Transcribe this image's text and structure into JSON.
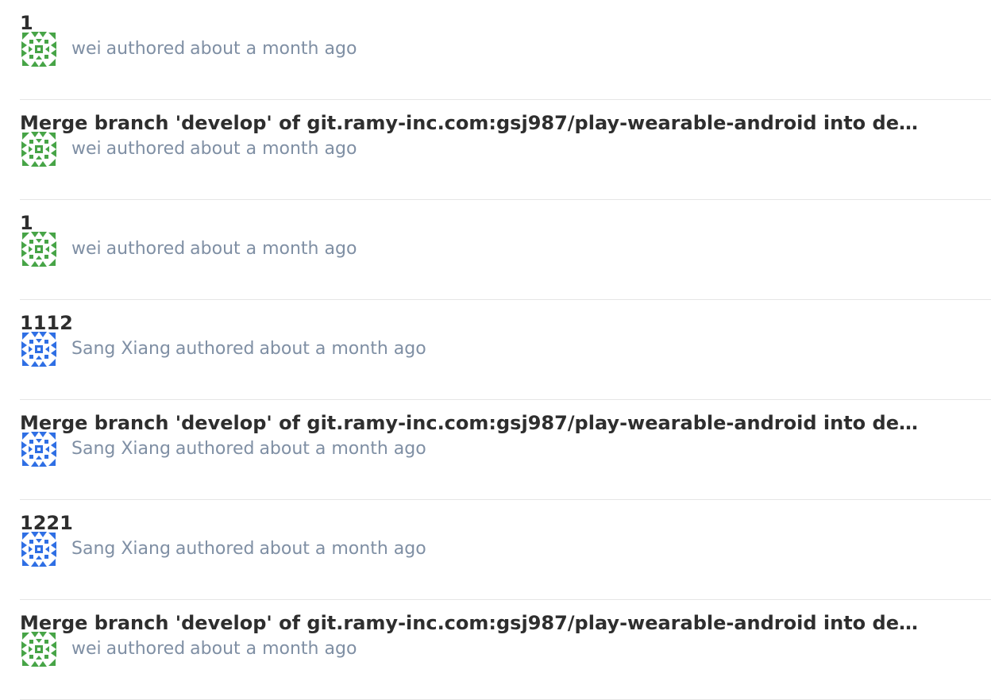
{
  "identicons": {
    "green": "#47a447",
    "blue": "#2f6fe4"
  },
  "commits": [
    {
      "title": "1",
      "author": "wei",
      "authored_word": "authored",
      "time": "about a month ago",
      "avatar_color": "green"
    },
    {
      "title": "Merge branch 'develop' of git.ramy-inc.com:gsj987/play-wearable-android into deve…",
      "author": "wei",
      "authored_word": "authored",
      "time": "about a month ago",
      "avatar_color": "green"
    },
    {
      "title": "1",
      "author": "wei",
      "authored_word": "authored",
      "time": "about a month ago",
      "avatar_color": "green"
    },
    {
      "title": "1112",
      "author": "Sang Xiang",
      "authored_word": "authored",
      "time": "about a month ago",
      "avatar_color": "blue"
    },
    {
      "title": "Merge branch 'develop' of git.ramy-inc.com:gsj987/play-wearable-android into deve…",
      "author": "Sang Xiang",
      "authored_word": "authored",
      "time": "about a month ago",
      "avatar_color": "blue"
    },
    {
      "title": "1221",
      "author": "Sang Xiang",
      "authored_word": "authored",
      "time": "about a month ago",
      "avatar_color": "blue"
    },
    {
      "title": "Merge branch 'develop' of git.ramy-inc.com:gsj987/play-wearable-android into deve…",
      "author": "wei",
      "authored_word": "authored",
      "time": "about a month ago",
      "avatar_color": "green"
    }
  ]
}
